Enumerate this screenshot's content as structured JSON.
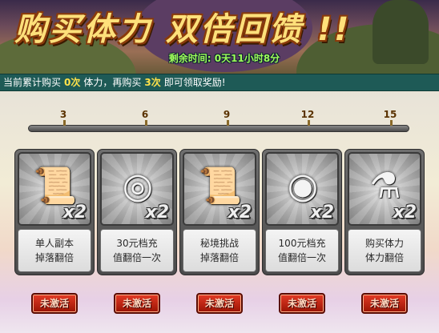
{
  "header": {
    "title": "购买体力  双倍回馈 !!",
    "timer": "剩余时间: 0天11小时8分"
  },
  "info": {
    "part1": "当前累计购买",
    "count": "0次",
    "part2": "体力，再购买",
    "remaining": "3次",
    "part3": "即可领取奖励!"
  },
  "progress": {
    "ticks": [
      "3",
      "6",
      "9",
      "12",
      "15"
    ],
    "current": 0,
    "max": 15
  },
  "rewards": [
    {
      "icon": "scroll-dungeon-icon",
      "glyph": "📜",
      "multiplier": "x2",
      "line1": "单人副本",
      "line2": "掉落翻倍",
      "status": "未激活"
    },
    {
      "icon": "silver-ingot-icon",
      "glyph": "◎",
      "multiplier": "x2",
      "line1": "30元档充",
      "line2": "值翻倍一次",
      "status": "未激活"
    },
    {
      "icon": "scroll-challenge-icon",
      "glyph": "📜",
      "multiplier": "x2",
      "line1": "秘境挑战",
      "line2": "掉落翻倍",
      "status": "未激活"
    },
    {
      "icon": "silver-ingots-pile-icon",
      "glyph": "◉",
      "multiplier": "x2",
      "line1": "100元档充",
      "line2": "值翻倍一次",
      "status": "未激活"
    },
    {
      "icon": "stamina-potion-icon",
      "glyph": "⚗",
      "multiplier": "x2",
      "line1": "购买体力",
      "line2": "体力翻倍",
      "status": "未激活"
    }
  ],
  "colors": {
    "accent_yellow": "#ffe24a",
    "timer_green": "#9fff5a",
    "status_red": "#c8220e",
    "info_bar": "#1e5a56"
  }
}
